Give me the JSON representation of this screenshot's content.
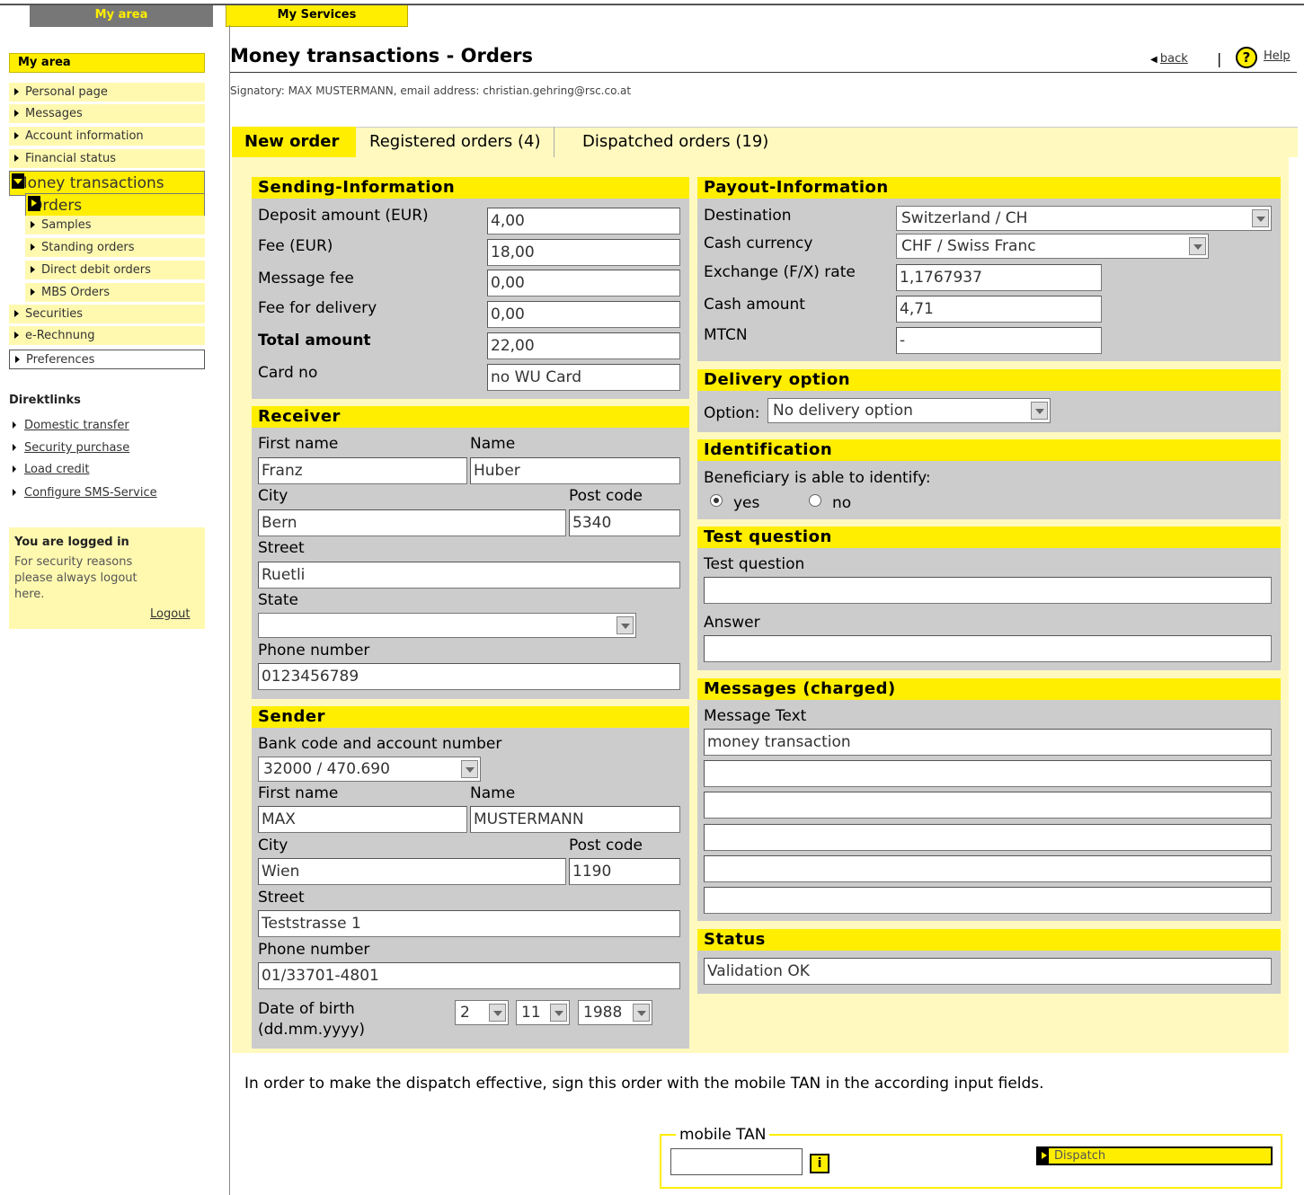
{
  "topnav": {
    "my_area": "My area",
    "my_services": "My Services"
  },
  "sidebar": {
    "heading": "My area",
    "items": [
      {
        "label": "Personal page"
      },
      {
        "label": "Messages"
      },
      {
        "label": "Account information"
      },
      {
        "label": "Financial status"
      },
      {
        "label": "Money transactions"
      },
      {
        "label": "Orders"
      },
      {
        "label": "Samples"
      },
      {
        "label": "Standing orders"
      },
      {
        "label": "Direct debit orders"
      },
      {
        "label": "MBS Orders"
      },
      {
        "label": "Securities"
      },
      {
        "label": "e-Rechnung"
      },
      {
        "label": "Preferences"
      }
    ],
    "direktlinks_heading": "Direktlinks",
    "direktlinks": [
      "Domestic transfer",
      "Security purchase",
      "Load credit",
      "Configure SMS-Service"
    ],
    "logged_title": "You are logged in",
    "logged_text": "For security reasons please always logout here.",
    "logout": "Logout"
  },
  "header": {
    "title": "Money transactions - Orders",
    "back": "back",
    "separator": "|",
    "help": "Help",
    "help_icon": "?",
    "signatory": "Signatory: MAX MUSTERMANN, email address: christian.gehring@rsc.co.at"
  },
  "tabs": {
    "new_order": "New order",
    "registered": "Registered orders (4)",
    "dispatched": "Dispatched orders (19)"
  },
  "sending": {
    "heading": "Sending-Information",
    "deposit_label": "Deposit amount (EUR)",
    "deposit": "4,00",
    "fee_label": "Fee (EUR)",
    "fee": "18,00",
    "msgfee_label": "Message fee",
    "msgfee": "0,00",
    "delivery_fee_label": "Fee for delivery",
    "delivery_fee": "0,00",
    "total_label": "Total amount",
    "total": "22,00",
    "card_label": "Card no",
    "card": "no WU Card"
  },
  "receiver": {
    "heading": "Receiver",
    "first_name_label": "First name",
    "first_name": "Franz",
    "name_label": "Name",
    "name": "Huber",
    "city_label": "City",
    "city": "Bern",
    "postcode_label": "Post code",
    "postcode": "5340",
    "street_label": "Street",
    "street": "Ruetli",
    "state_label": "State",
    "state": "",
    "phone_label": "Phone number",
    "phone": "0123456789"
  },
  "sender": {
    "heading": "Sender",
    "bank_label": "Bank code and account number",
    "bank": "32000 / 470.690",
    "first_name_label": "First name",
    "first_name": "MAX",
    "name_label": "Name",
    "name": "MUSTERMANN",
    "city_label": "City",
    "city": "Wien",
    "postcode_label": "Post code",
    "postcode": "1190",
    "street_label": "Street",
    "street": "Teststrasse 1",
    "phone_label": "Phone number",
    "phone": "01/33701-4801",
    "dob_label": "Date of birth",
    "dob_format": "(dd.mm.yyyy)",
    "dob_day": "2",
    "dob_month": "11",
    "dob_year": "1988"
  },
  "payout": {
    "heading": "Payout-Information",
    "destination_label": "Destination",
    "destination": "Switzerland / CH",
    "currency_label": "Cash currency",
    "currency": "CHF / Swiss Franc",
    "rate_label": "Exchange (F/X) rate",
    "rate": "1,1767937",
    "amount_label": "Cash amount",
    "amount": "4,71",
    "mtcn_label": "MTCN",
    "mtcn": "-"
  },
  "delivery": {
    "heading": "Delivery option",
    "option_label": "Option:",
    "option": "No delivery option"
  },
  "identification": {
    "heading": "Identification",
    "question": "Beneficiary is able to identify:",
    "yes": "yes",
    "no": "no"
  },
  "test_question": {
    "heading": "Test question",
    "question_label": "Test question",
    "question": "",
    "answer_label": "Answer",
    "answer": ""
  },
  "messages": {
    "heading": "Messages (charged)",
    "text_label": "Message Text",
    "lines": [
      "money transaction",
      "",
      "",
      "",
      "",
      ""
    ]
  },
  "status": {
    "heading": "Status",
    "value": "Validation OK"
  },
  "footer": {
    "note": "In order to make the dispatch effective, sign this order with the mobile TAN in the according input fields.",
    "tan_label": "mobile TAN",
    "tan_value": "",
    "info_icon": "i",
    "dispatch": "Dispatch"
  },
  "colors": {
    "accent": "#ffee00",
    "light_yellow": "#fff9c0",
    "panel": "#cccccc"
  }
}
